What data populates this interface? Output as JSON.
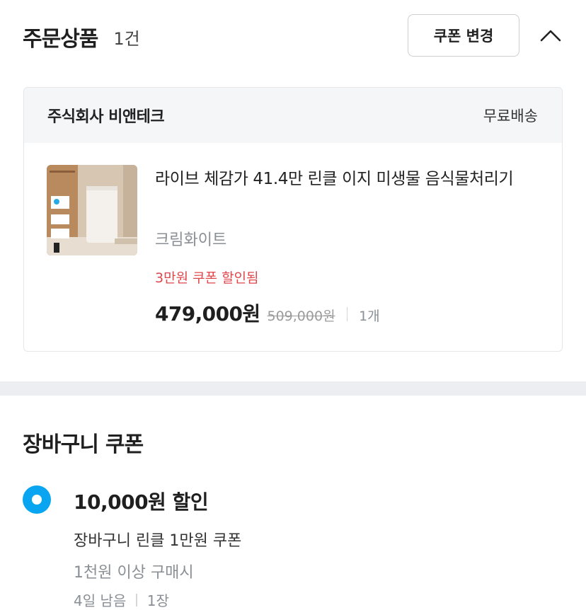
{
  "order": {
    "title": "주문상품",
    "count": "1건",
    "coupon_button": "쿠폰 변경",
    "collapse_icon": "chevron-up-icon"
  },
  "seller_card": {
    "seller_name": "주식회사 비앤테크",
    "shipping": "무료배송",
    "product": {
      "name": "라이브 체감가 41.4만 린클 이지 미생물 음식물처리기",
      "option": "크림화이트",
      "discount_note": "3만원 쿠폰 할인됨",
      "price": "479,000원",
      "original_price": "509,000원",
      "quantity": "1개"
    }
  },
  "cart_coupon": {
    "title": "장바구니 쿠폰",
    "selected": true,
    "amount": "10,000원 할인",
    "name": "장바구니 린클 1만원 쿠폰",
    "condition": "1천원 이상 구매시",
    "remaining": "4일 남음",
    "count": "1장"
  },
  "colors": {
    "accent": "#0aa5f0",
    "discount": "#e0474c",
    "muted": "#8a8f96"
  }
}
